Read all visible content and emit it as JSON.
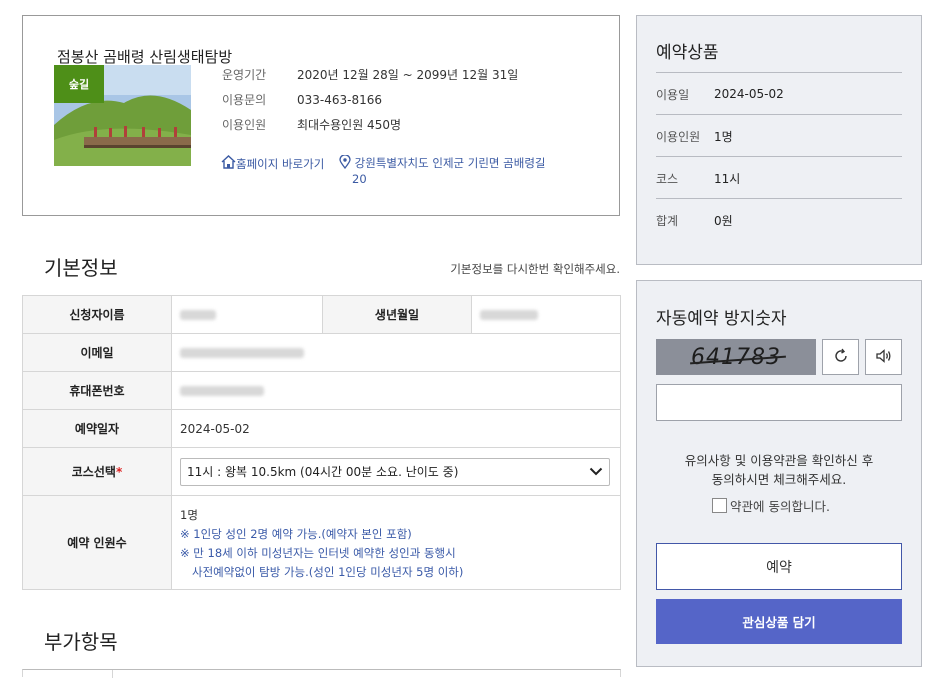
{
  "product": {
    "title": "점봉산 곰배령 산림생태탐방",
    "badge": "숲길",
    "info": [
      {
        "label": "운영기간",
        "value": "2020년 12월 28일 ~ 2099년 12월 31일"
      },
      {
        "label": "이용문의",
        "value": "033-463-8166"
      },
      {
        "label": "이용인원",
        "value": "최대수용인원 450명"
      }
    ],
    "homepage_link": "홈페이지 바로가기",
    "address_line1": "강원특별자치도 인제군 기린면 곰배령길",
    "address_line2": "20"
  },
  "basic_info": {
    "title": "기본정보",
    "hint": "기본정보를 다시한번 확인해주세요.",
    "labels": {
      "applicant": "신청자이름",
      "birth": "생년월일",
      "email": "이메일",
      "phone": "휴대폰번호",
      "date": "예약일자",
      "course": "코스선택",
      "required_mark": "*",
      "headcount": "예약 인원수"
    },
    "date_value": "2024-05-02",
    "course_value": "11시 : 왕복 10.5km (04시간 00분 소요. 난이도 중)",
    "headcount_value": "1명",
    "notes": [
      "※ 1인당 성인 2명 예약 가능.(예약자 본인 포함)",
      "※ 만 18세 이하 미성년자는 인터넷 예약한 성인과 동행시",
      "사전예약없이 탐방 가능.(성인 1인당 미성년자 5명 이하)"
    ]
  },
  "extra": {
    "title": "부가항목"
  },
  "summary": {
    "title": "예약상품",
    "rows": [
      {
        "label": "이용일",
        "value": "2024-05-02"
      },
      {
        "label": "이용인원",
        "value": "1명"
      },
      {
        "label": "코스",
        "value": "11시"
      },
      {
        "label": "합계",
        "value": "0원"
      }
    ]
  },
  "captcha": {
    "title": "자동예약 방지숫자",
    "code": "641783",
    "agree_text_1": "유의사항 및 이용약관을 확인하신 후",
    "agree_text_2": "동의하시면 체크해주세요.",
    "agree_label": "약관에 동의합니다.",
    "reserve_button": "예약",
    "wishlist_button": "관심상품 담기"
  },
  "colors": {
    "badge": "#4e8f18",
    "link": "#3b5aa3",
    "primary_button": "#5565c8",
    "panel_bg": "#eef0f4"
  },
  "icons": [
    "home-icon",
    "location-pin-icon",
    "chevron-down-icon",
    "refresh-icon",
    "speaker-icon"
  ]
}
